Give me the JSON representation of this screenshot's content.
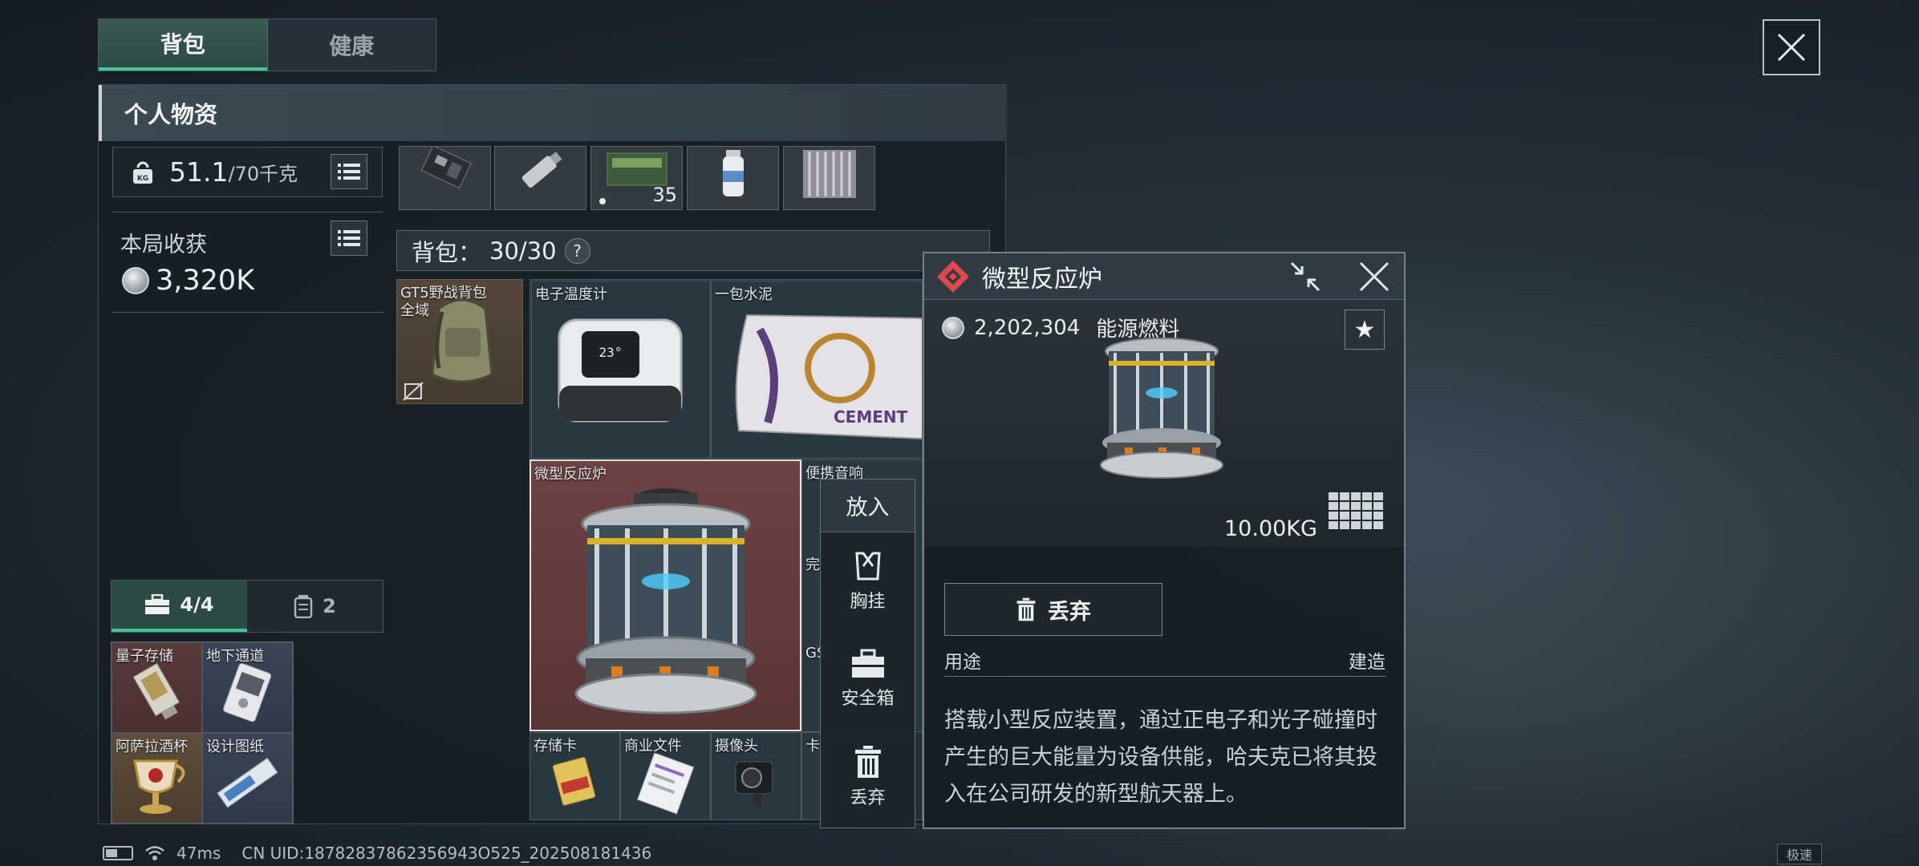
{
  "tabs": [
    {
      "label": "背包",
      "active": true
    },
    {
      "label": "健康",
      "active": false
    }
  ],
  "panel": {
    "title": "个人物资"
  },
  "weight": {
    "value": "51.1",
    "max": "/70千克",
    "icon": "weight-icon"
  },
  "harvest": {
    "label": "本局收获",
    "value": "3,320K"
  },
  "bottom_tabs": [
    {
      "label": "4/4",
      "icon": "briefcase-icon",
      "active": true
    },
    {
      "label": "2",
      "icon": "canister-icon",
      "active": false
    }
  ],
  "safe_items": [
    "量子存储",
    "地下通道",
    "阿萨拉酒杯",
    "设计图纸"
  ],
  "top_row": {
    "stack_count": "35"
  },
  "backpack": {
    "label": "背包：",
    "capacity": "30/30",
    "help": "?"
  },
  "backpack_items": {
    "gt5": "GT5野战背包",
    "gt5_sub": "全域",
    "thermometer": "电子温度计",
    "cement": "一包水泥",
    "reactor": "微型反应炉",
    "speaker": "便携音响",
    "storage_card": "存储卡",
    "business_doc": "商业文件",
    "camera": "摄像头",
    "card_partial": "卡",
    "partial_wan": "完",
    "partial_gs": "GS"
  },
  "context_menu": {
    "header": "放入",
    "items": [
      {
        "label": "胸挂",
        "icon": "vest-icon"
      },
      {
        "label": "安全箱",
        "icon": "safebox-icon"
      },
      {
        "label": "丢弃",
        "icon": "trash-icon"
      }
    ]
  },
  "detail": {
    "title": "微型反应炉",
    "price": "2,202,304",
    "category": "能源燃料",
    "weight": "10.00KG",
    "drop_label": "丢弃",
    "use_label": "用途",
    "use_value": "建造",
    "description": "搭载小型反应装置，通过正电子和光子碰撞时产生的巨大能量为设备供能，哈夫克已将其投入在公司研发的新型航天器上。"
  },
  "status_bar": {
    "ping": "47ms",
    "uid": "CN UID:18782837862356943O525_202508181436",
    "speed": "极速"
  },
  "colors": {
    "accent_green": "#3fc59a",
    "rarity_red": "#e0474c",
    "reactor_bg": "#6d4243"
  }
}
